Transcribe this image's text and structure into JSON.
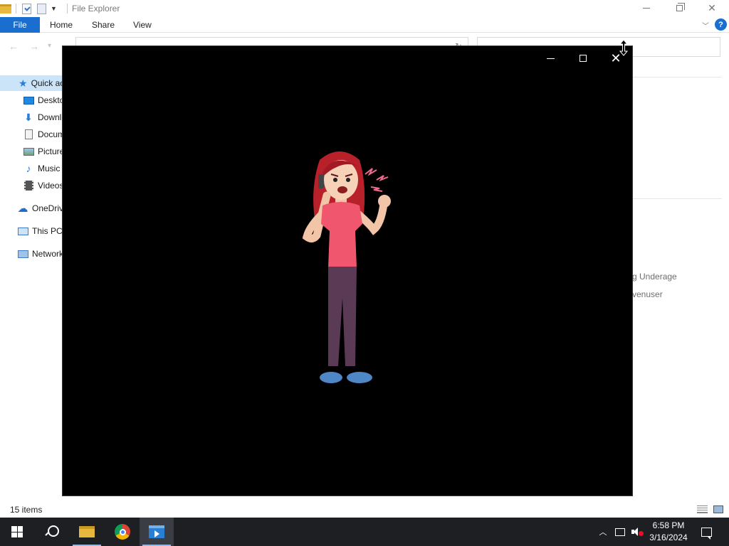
{
  "file_explorer": {
    "title": "File Explorer",
    "ribbon": {
      "file": "File",
      "home": "Home",
      "share": "Share",
      "view": "View",
      "help": "?"
    },
    "nav_pane": [
      {
        "label": "Quick access",
        "icon": "quick-access-star-icon"
      },
      {
        "label": "Desktop",
        "icon": "desktop-icon"
      },
      {
        "label": "Downloads",
        "icon": "downloads-arrow-icon"
      },
      {
        "label": "Documents",
        "icon": "documents-icon"
      },
      {
        "label": "Pictures",
        "icon": "pictures-icon"
      },
      {
        "label": "Music",
        "icon": "music-note-icon"
      },
      {
        "label": "Videos",
        "icon": "videos-film-icon"
      },
      {
        "label": "OneDrive",
        "icon": "onedrive-cloud-icon"
      },
      {
        "label": "This PC",
        "icon": "this-pc-icon"
      },
      {
        "label": "Network",
        "icon": "network-icon"
      }
    ],
    "content_fragments": [
      "g Underage",
      "venuser"
    ],
    "status": "15 items"
  },
  "media_player": {
    "content": "cartoon of angry woman talking on phone",
    "colors": {
      "background": "#000000",
      "shirt": "#f0576e",
      "pants": "#5b3a55",
      "hair": "#b8202a",
      "shoes": "#4f86c6"
    }
  },
  "taskbar": {
    "time": "6:58 PM",
    "date": "3/16/2024",
    "apps": [
      "start-windows-icon",
      "search-icon",
      "file-explorer-icon",
      "chrome-icon",
      "media-player-icon"
    ]
  },
  "colors": {
    "accent": "#1a6ecf",
    "taskbar": "#1d1f23",
    "selection": "#cce4f7"
  }
}
